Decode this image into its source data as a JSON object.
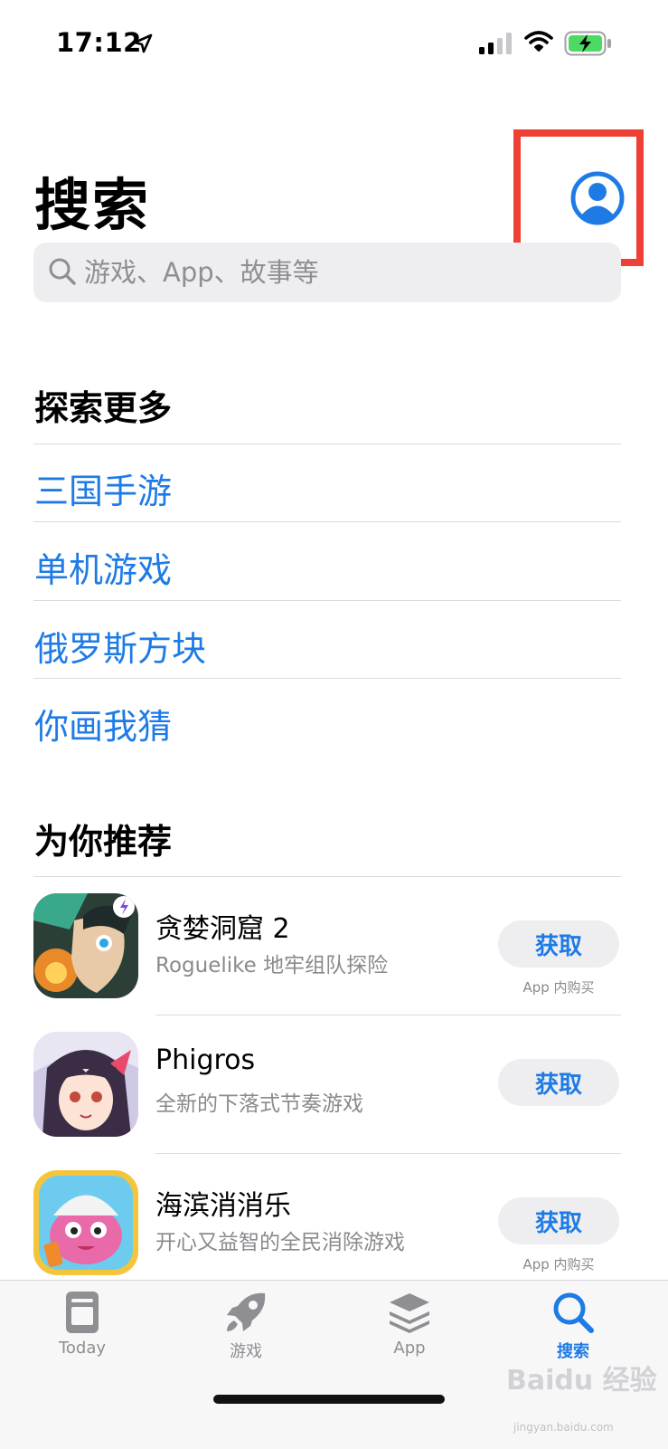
{
  "status_bar": {
    "time": "17:12"
  },
  "header": {
    "title": "搜索"
  },
  "search": {
    "placeholder": "游戏、App、故事等"
  },
  "explore": {
    "title": "探索更多",
    "links": [
      "三国手游",
      "单机游戏",
      "俄罗斯方块",
      "你画我猜"
    ]
  },
  "recommended": {
    "title": "为你推荐",
    "apps": [
      {
        "name": "贪婪洞窟 2",
        "subtitle": "Roguelike 地牢组队探险",
        "get_label": "获取",
        "iap": "App 内购买"
      },
      {
        "name": "Phigros",
        "subtitle": "全新的下落式节奏游戏",
        "get_label": "获取",
        "iap": ""
      },
      {
        "name": "海滨消消乐",
        "subtitle": "开心又益智的全民消除游戏",
        "get_label": "获取",
        "iap": "App 内购买"
      }
    ]
  },
  "tabs": [
    {
      "label": "Today",
      "icon": "today-icon"
    },
    {
      "label": "游戏",
      "icon": "rocket-icon"
    },
    {
      "label": "App",
      "icon": "layers-icon"
    },
    {
      "label": "搜索",
      "icon": "search-icon",
      "active": true
    }
  ],
  "watermark": {
    "text": "Baidu 经验",
    "sub": "jingyan.baidu.com"
  },
  "colors": {
    "accent": "#1e7be6",
    "highlight": "#ee4035",
    "battery": "#4cd964"
  }
}
